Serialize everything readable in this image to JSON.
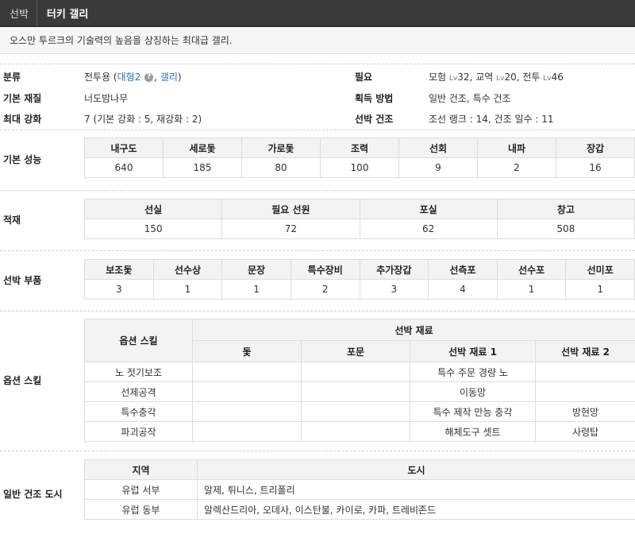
{
  "header": {
    "category": "선박",
    "title": "터키 갤리"
  },
  "description": "오스만 투르크의 기술력의 높음을 상징하는 최대급 갤리.",
  "info": {
    "class_label": "분류",
    "class_prefix": "전투용 (",
    "class_link1": "대형2",
    "class_sep": ",",
    "class_link2": "갤리",
    "class_suffix": ")",
    "req_label": "필요",
    "req": [
      {
        "name": "모험",
        "lv": "Lv",
        "val": "32"
      },
      {
        "name": "교역",
        "lv": "Lv",
        "val": "20"
      },
      {
        "name": "전투",
        "lv": "Lv",
        "val": "46"
      }
    ],
    "material_label": "기본 재질",
    "material": "너도밤나무",
    "acquire_label": "획득 방법",
    "acquire": "일반 건조, 특수 건조",
    "max_label": "최대 강화",
    "max": "7 (기본 강화 : 5, 재강화 : 2)",
    "build_label": "선박 건조",
    "build": "조선 랭크 : 14, 건조 일수 : 11"
  },
  "perf": {
    "label": "기본 성능",
    "headers": [
      "내구도",
      "세로돛",
      "가로돛",
      "조력",
      "선회",
      "내파",
      "장갑"
    ],
    "values": [
      "640",
      "185",
      "80",
      "100",
      "9",
      "2",
      "16"
    ]
  },
  "cargo": {
    "label": "적재",
    "headers": [
      "선실",
      "필요 선원",
      "포실",
      "창고"
    ],
    "values": [
      "150",
      "72",
      "62",
      "508"
    ]
  },
  "parts": {
    "label": "선박 부품",
    "headers": [
      "보조돛",
      "선수상",
      "문장",
      "특수장비",
      "추가장갑",
      "선측포",
      "선수포",
      "선미포"
    ],
    "values": [
      "3",
      "1",
      "1",
      "2",
      "3",
      "4",
      "1",
      "1"
    ]
  },
  "options": {
    "label": "옵션 스킬",
    "skill_header": "옵션 스킬",
    "material_header": "선박 재료",
    "sub_headers": [
      "돛",
      "포문",
      "선박 재료 1",
      "선박 재료 2"
    ],
    "rows": [
      {
        "skill": "노 젓기보조",
        "sail": "",
        "gun": "",
        "m1": "특수 주문 경량 노",
        "m2": ""
      },
      {
        "skill": "선제공격",
        "sail": "",
        "gun": "",
        "m1": "이동망",
        "m2": ""
      },
      {
        "skill": "특수충각",
        "sail": "",
        "gun": "",
        "m1": "특수 제작 만능 충각",
        "m2": "방현망"
      },
      {
        "skill": "파괴공작",
        "sail": "",
        "gun": "",
        "m1": "해체도구 셋트",
        "m2": "사령탑"
      }
    ]
  },
  "cities": {
    "label": "일반 건조 도시",
    "region_header": "지역",
    "city_header": "도시",
    "rows": [
      {
        "region": "유럽 서부",
        "cities": "알제, 튀니스, 트리폴리"
      },
      {
        "region": "유럽 동부",
        "cities": "알렉산드리아, 오데사, 이스탄불, 카이로, 카파, 트레비존드"
      }
    ]
  }
}
